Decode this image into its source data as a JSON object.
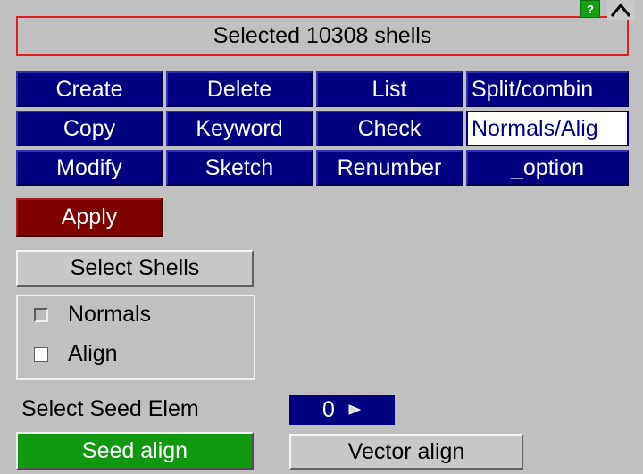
{
  "status_text": "Selected 10308 shells",
  "help_label": "?",
  "tabs": {
    "row1": [
      "Create",
      "Delete",
      "List",
      "Split/combin"
    ],
    "row2": [
      "Copy",
      "Keyword",
      "Check",
      "Normals/Alig"
    ],
    "row3": [
      "Modify",
      "Sketch",
      "Renumber",
      "_option"
    ]
  },
  "apply_label": "Apply",
  "select_shells_label": "Select Shells",
  "options": {
    "normals_label": "Normals",
    "align_label": "Align"
  },
  "seed": {
    "label": "Select Seed Elem",
    "value": "0"
  },
  "seed_align_label": "Seed align",
  "vector_align_label": "Vector align",
  "colors": {
    "tab_bg": "#000080",
    "apply_bg": "#800000",
    "seed_align_bg": "#109810",
    "status_border": "#e02020",
    "panel_bg": "#c0c0c0"
  }
}
